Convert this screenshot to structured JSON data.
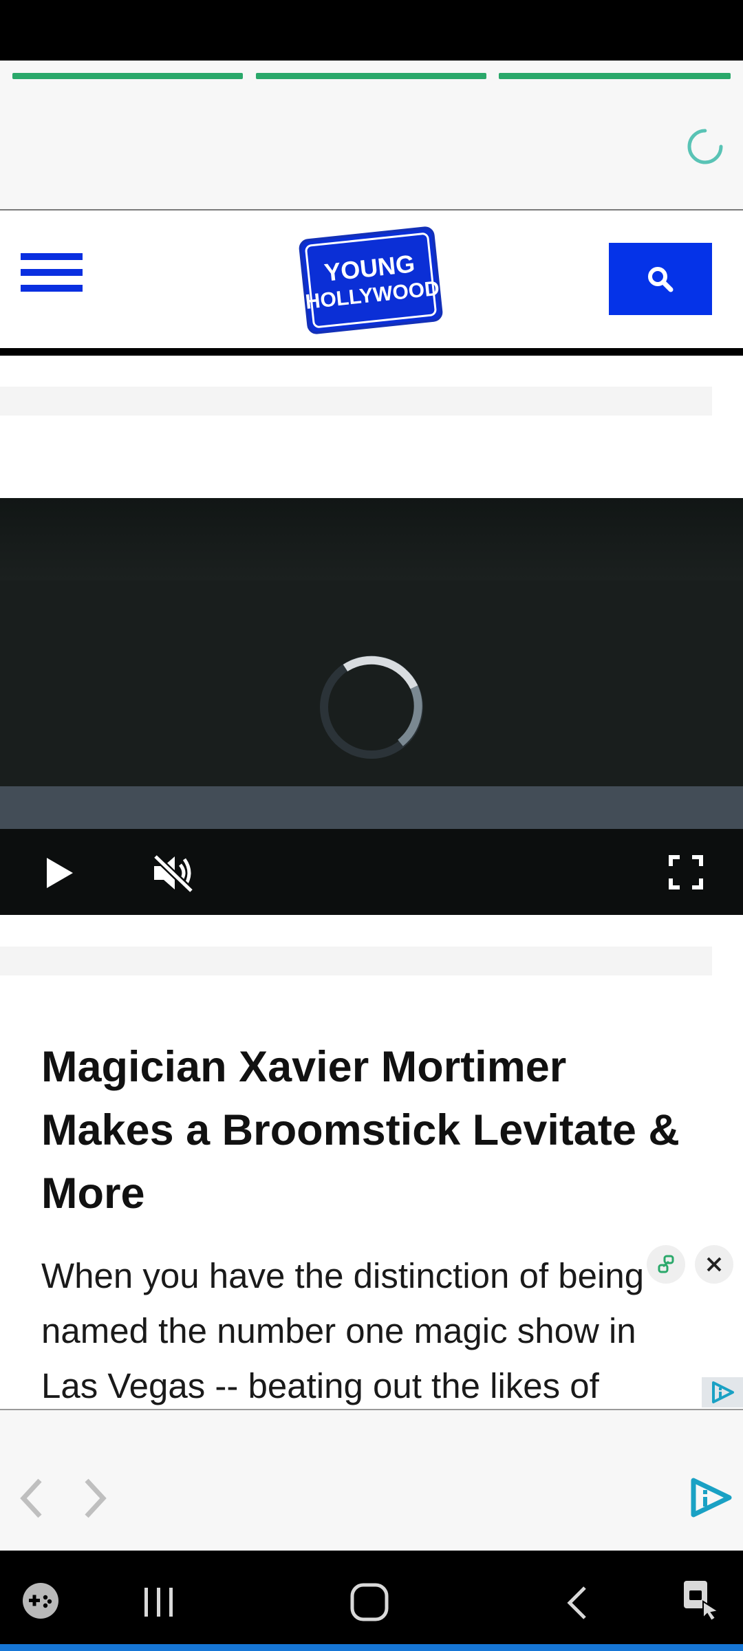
{
  "app": {
    "brand_logo_text": [
      "YOUNG",
      "HOLLYWOOD"
    ],
    "colors": {
      "brand_blue": "#0533e8",
      "story_progress_green": "#2aa86a",
      "loader_teal": "#59c3b5",
      "ad_brand_teal": "#1aa1c4"
    }
  },
  "story_bar": {
    "segments": [
      "story-1",
      "story-2",
      "story-3"
    ],
    "loading_icon": "spinner-icon"
  },
  "header": {
    "menu_icon": "hamburger-menu-icon",
    "search_icon": "search-icon"
  },
  "video_player": {
    "state": "loading",
    "controls": {
      "play_icon": "play-icon",
      "mute_icon": "muted-speaker-icon",
      "fullscreen_icon": "fullscreen-icon"
    }
  },
  "article": {
    "title": "Magician Xavier Mortimer Makes a Broomstick Levitate & More",
    "body": "When you have the distinction of being named the number one magic show in Las Vegas -- beating out the likes of"
  },
  "ad": {
    "close_icon": "close-icon",
    "link_icon": "link-icon",
    "adchoices_icon": "adchoices-icon",
    "prev_icon": "chevron-left-icon",
    "next_icon": "chevron-right-icon",
    "brand_icon": "ad-brand-play-icon"
  },
  "system_nav": {
    "game_icon": "game-launcher-icon",
    "recents_icon": "recent-apps-icon",
    "home_icon": "home-icon",
    "back_icon": "back-icon",
    "accessibility_icon": "accessibility-touch-icon"
  }
}
